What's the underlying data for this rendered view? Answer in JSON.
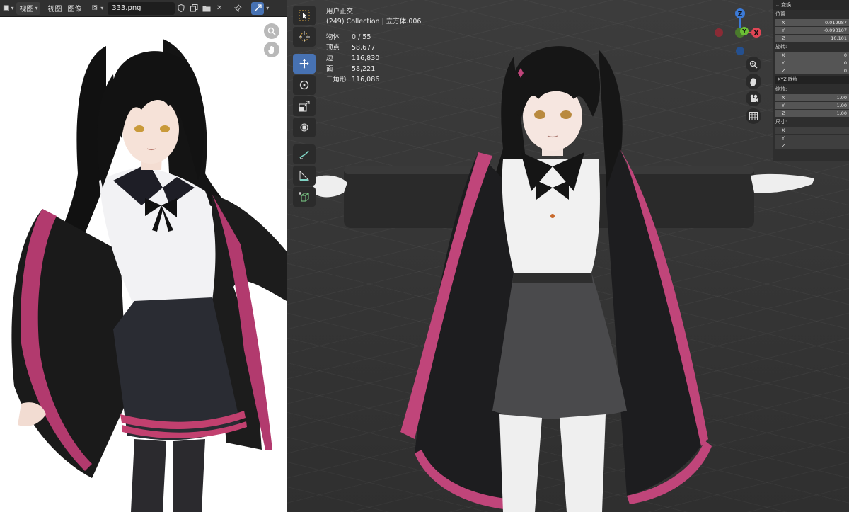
{
  "image_editor": {
    "header": {
      "view_menu_left": "视图",
      "view_menu": "视图",
      "image_menu": "图像",
      "image_name": "333.png"
    }
  },
  "viewport": {
    "view_name": "用户正交",
    "collection_line": "(249) Collection | 立方体.006",
    "stats": [
      {
        "label": "物体",
        "value": "0 / 55"
      },
      {
        "label": "顶点",
        "value": "58,677"
      },
      {
        "label": "边",
        "value": "116,830"
      },
      {
        "label": "面",
        "value": "58,221"
      },
      {
        "label": "三角形",
        "value": "116,086"
      }
    ],
    "gizmo": {
      "x": "X",
      "y": "Y",
      "z": "Z"
    }
  },
  "n_panel": {
    "title": "变换",
    "location_label": "位置",
    "location": [
      {
        "axis": "X",
        "value": "-0.019987"
      },
      {
        "axis": "Y",
        "value": "-0.093107"
      },
      {
        "axis": "Z",
        "value": "10.101"
      }
    ],
    "rotation_label": "旋转:",
    "rotation": [
      {
        "axis": "X",
        "value": "0"
      },
      {
        "axis": "Y",
        "value": "0"
      },
      {
        "axis": "Z",
        "value": "0"
      }
    ],
    "rotation_mode": "XYZ 欧拉",
    "scale_label": "缩放:",
    "scale": [
      {
        "axis": "X",
        "value": "1.00"
      },
      {
        "axis": "Y",
        "value": "1.00"
      },
      {
        "axis": "Z",
        "value": "1.00"
      }
    ],
    "dimensions_label": "尺寸:",
    "dimensions": [
      {
        "axis": "X",
        "value": ""
      },
      {
        "axis": "Y",
        "value": ""
      },
      {
        "axis": "Z",
        "value": ""
      }
    ]
  }
}
